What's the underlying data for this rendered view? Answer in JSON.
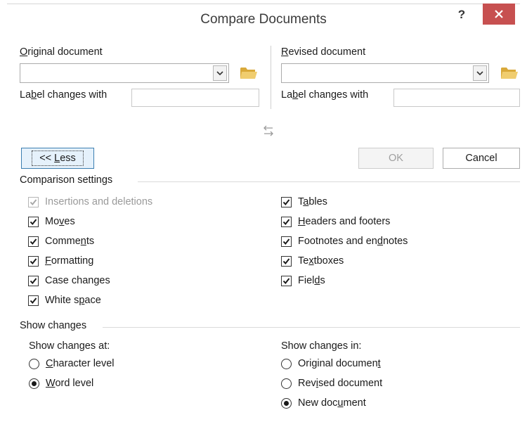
{
  "dialog": {
    "title": "Compare Documents",
    "help_label": "?",
    "close_icon": "close-icon"
  },
  "original": {
    "label_pre": "",
    "label_u": "O",
    "label_post": "riginal document",
    "value": "",
    "label_changes_pre": "La",
    "label_changes_u": "b",
    "label_changes_post": "el changes with",
    "label_changes_value": ""
  },
  "revised": {
    "label_pre": "",
    "label_u": "R",
    "label_post": "evised document",
    "value": "",
    "label_changes_pre": "La",
    "label_changes_u": "b",
    "label_changes_post": "el changes with",
    "label_changes_value": ""
  },
  "buttons": {
    "less_pre": "<< ",
    "less_u": "L",
    "less_post": "ess",
    "ok": "OK",
    "cancel": "Cancel"
  },
  "comparison": {
    "heading": "Comparison settings",
    "left": [
      {
        "pre": "Insertions and deletions",
        "u": "",
        "post": "",
        "checked": true,
        "disabled": true
      },
      {
        "pre": "Mo",
        "u": "v",
        "post": "es",
        "checked": true,
        "disabled": false
      },
      {
        "pre": "Comme",
        "u": "n",
        "post": "ts",
        "checked": true,
        "disabled": false
      },
      {
        "pre": "",
        "u": "F",
        "post": "ormatting",
        "checked": true,
        "disabled": false
      },
      {
        "pre": "Case chan",
        "u": "g",
        "post": "es",
        "checked": true,
        "disabled": false
      },
      {
        "pre": "White s",
        "u": "p",
        "post": "ace",
        "checked": true,
        "disabled": false
      }
    ],
    "right": [
      {
        "pre": "T",
        "u": "a",
        "post": "bles",
        "checked": true,
        "disabled": false
      },
      {
        "pre": "",
        "u": "H",
        "post": "eaders and footers",
        "checked": true,
        "disabled": false
      },
      {
        "pre": "Footnotes and en",
        "u": "d",
        "post": "notes",
        "checked": true,
        "disabled": false
      },
      {
        "pre": "Te",
        "u": "x",
        "post": "tboxes",
        "checked": true,
        "disabled": false
      },
      {
        "pre": "Fiel",
        "u": "d",
        "post": "s",
        "checked": true,
        "disabled": false
      }
    ]
  },
  "show_changes": {
    "heading": "Show changes",
    "at_label": "Show changes at:",
    "at_options": [
      {
        "pre": "",
        "u": "C",
        "post": "haracter level",
        "selected": false
      },
      {
        "pre": "",
        "u": "W",
        "post": "ord level",
        "selected": true
      }
    ],
    "in_label": "Show changes in:",
    "in_options": [
      {
        "pre": "Original documen",
        "u": "t",
        "post": "",
        "selected": false
      },
      {
        "pre": "Rev",
        "u": "i",
        "post": "sed document",
        "selected": false
      },
      {
        "pre": "New doc",
        "u": "u",
        "post": "ment",
        "selected": true
      }
    ]
  },
  "colors": {
    "close_button": "#c75050",
    "less_border": "#3c7fb1",
    "folder": "#e8c26a"
  }
}
